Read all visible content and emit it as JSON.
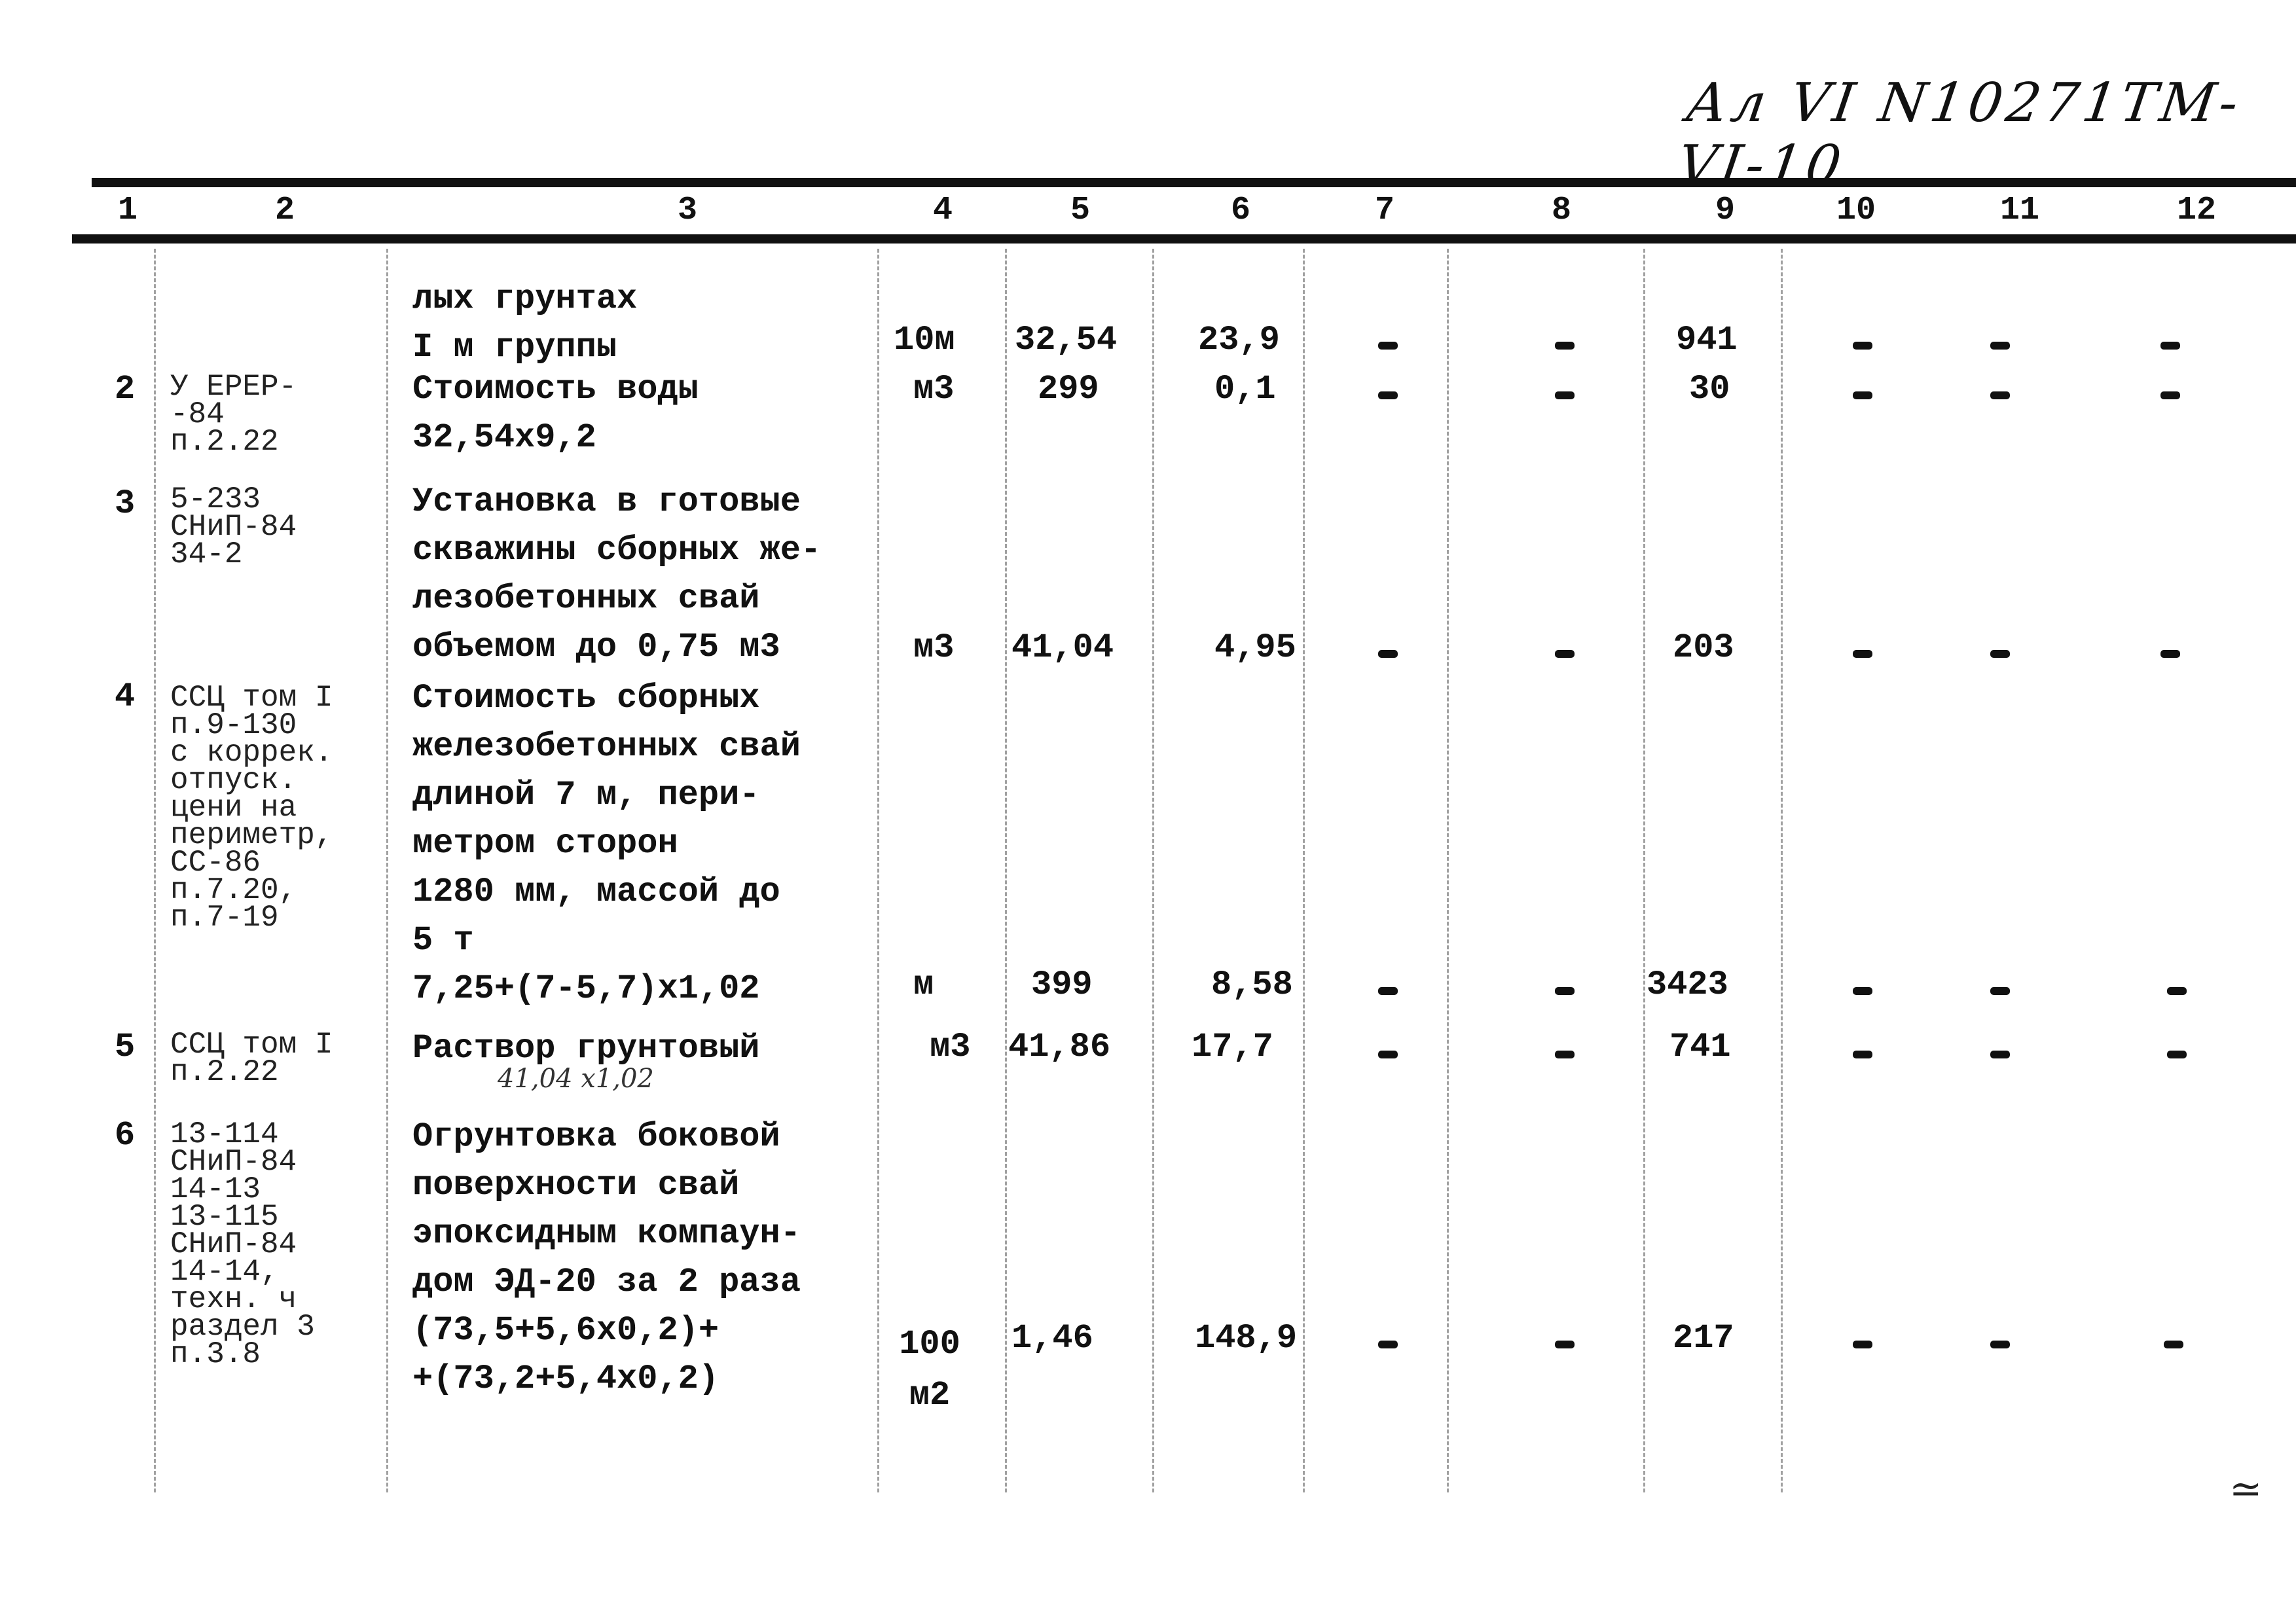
{
  "document": {
    "stamp": "Ал VI N10271ТМ-VI-10",
    "corner_mark": "≃",
    "columns": [
      "1",
      "2",
      "3",
      "4",
      "5",
      "6",
      "7",
      "8",
      "9",
      "10",
      "11",
      "12"
    ]
  },
  "rows": [
    {
      "no": "",
      "ref": "",
      "desc": "лых грунтах\nI м группы",
      "unit": "10м",
      "qty": "32,54",
      "price": "23,9",
      "c7": "-",
      "c8": "-",
      "total": "941",
      "c10": "-",
      "c11": "-",
      "c12": "-"
    },
    {
      "no": "2",
      "ref": "У ЕРЕР-\n-84\nп.2.22",
      "desc": "Стоимость воды\n32,54х9,2",
      "unit": "м3",
      "qty": "299",
      "price": "0,1",
      "c7": "-",
      "c8": "-",
      "total": "30",
      "c10": "-",
      "c11": "-",
      "c12": "-"
    },
    {
      "no": "3",
      "ref": "5-233\nСНиП-84\n34-2",
      "desc": "Установка в готовые\nскважины сборных же-\nлезобетонных свай\nобъемом до 0,75 м3",
      "unit": "м3",
      "qty": "41,04",
      "price": "4,95",
      "c7": "-",
      "c8": "-",
      "total": "203",
      "c10": "-",
      "c11": "-",
      "c12": "-"
    },
    {
      "no": "4",
      "ref": "ССЦ том I\nп.9-130\nс коррек.\nотпуск.\nцени на\nпериметр,\nСС-86\nп.7.20,\nп.7-19",
      "desc": "Стоимость сборных\nжелезобетонных свай\nдлиной 7 м, пери-\nметром сторон\n1280 мм, массой до\n5 т\n7,25+(7-5,7)х1,02",
      "unit": "м",
      "qty": "399",
      "price": "8,58",
      "c7": "-",
      "c8": "-",
      "total": "3423",
      "c10": "-",
      "c11": "-",
      "c12": "-"
    },
    {
      "no": "5",
      "ref": "ССЦ том I\nп.2.22",
      "desc": "Раствор грунтовый",
      "note": "41,04 х1,02",
      "unit": "м3",
      "qty": "41,86",
      "price": "17,7",
      "c7": "-",
      "c8": "-",
      "total": "741",
      "c10": "-",
      "c11": "-",
      "c12": "-"
    },
    {
      "no": "6",
      "ref": "13-114\nСНиП-84\n14-13\n13-115\nСНиП-84\n14-14,\nтехн. ч\nраздел 3\nп.3.8",
      "desc": "Огрунтовка боковой\nповерхности свай\nэпоксидным компаун-\nдом ЭД-20 за 2 раза\n(73,5+5,6х0,2)+\n+(73,2+5,4х0,2)",
      "unit": "100\nм2",
      "qty": "1,46",
      "price": "148,9",
      "c7": "-",
      "c8": "-",
      "total": "217",
      "c10": "-",
      "c11": "-",
      "c12": "-"
    }
  ]
}
